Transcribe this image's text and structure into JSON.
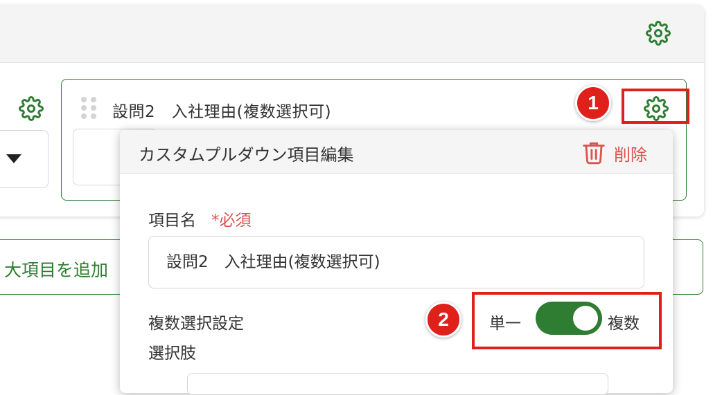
{
  "question": {
    "title": "設問2　入社理由(複数選択可)"
  },
  "add_button": {
    "label": "大項目を追加"
  },
  "annotations": {
    "badge1": "1",
    "badge2": "2"
  },
  "popup": {
    "title": "カスタムプルダウン項目編集",
    "delete_label": "削除",
    "item_name_label": "項目名",
    "required_label": "*必須",
    "item_name_value": "設問2　入社理由(複数選択可)",
    "multi_select_label": "複数選択設定",
    "choices_label": "選択肢",
    "toggle": {
      "left_label": "単一",
      "right_label": "複数",
      "state": "複数"
    }
  },
  "icons": {
    "settings": "gear-icon",
    "delete": "trash-icon",
    "drag": "drag-handle-icon",
    "dropdown": "caret-down-icon"
  },
  "colors": {
    "accent_green": "#2e7d32",
    "danger_red": "#d9534f",
    "highlight_red": "#e0201b"
  }
}
